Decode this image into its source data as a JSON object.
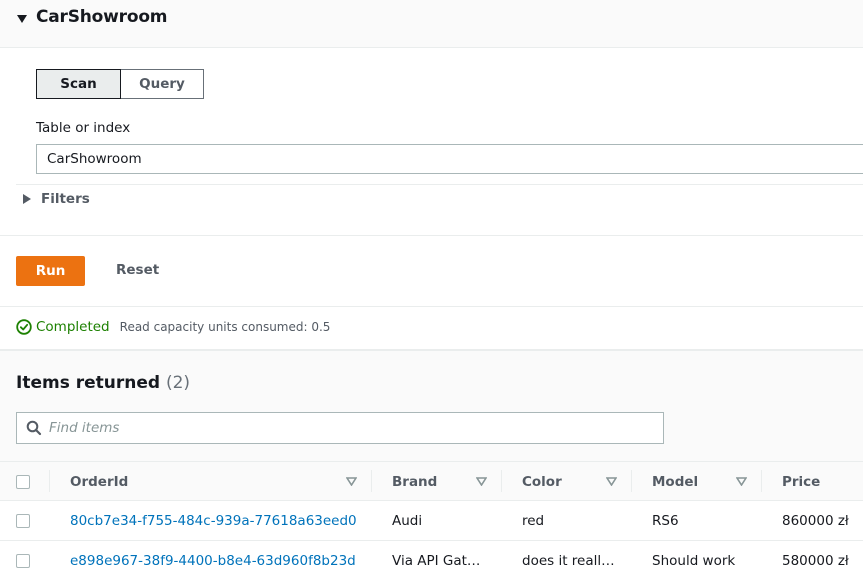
{
  "header": {
    "title": "CarShowroom",
    "caret_icon": "caret-down-icon"
  },
  "mode": {
    "options": [
      {
        "label": "Scan",
        "selected": true
      },
      {
        "label": "Query",
        "selected": false
      }
    ]
  },
  "table_or_index": {
    "label": "Table or index",
    "value": "CarShowroom"
  },
  "filters": {
    "label": "Filters",
    "caret_icon": "caret-right-icon"
  },
  "actions": {
    "run_label": "Run",
    "reset_label": "Reset"
  },
  "colors": {
    "accent": "#ec7211",
    "link": "#0073bb",
    "success": "#1d8102"
  },
  "status": {
    "state": "Completed",
    "message": "Read capacity units consumed: 0.5",
    "icon": "check-circle-icon"
  },
  "results": {
    "heading": "Items returned",
    "count": "(2)",
    "search": {
      "placeholder": "Find items",
      "value": ""
    },
    "columns": [
      "OrderId",
      "Brand",
      "Color",
      "Model",
      "Price"
    ],
    "rows": [
      {
        "OrderId": "80cb7e34-f755-484c-939a-77618a63eed0",
        "Brand": "Audi",
        "Color": "red",
        "Model": "RS6",
        "Price": "860000 zł"
      },
      {
        "OrderId": "e898e967-38f9-4400-b8e4-63d960f8b23d",
        "Brand": "Via API Gat…",
        "Color": "does it reall…",
        "Model": "Should work",
        "Price": "580000 zł"
      }
    ]
  }
}
